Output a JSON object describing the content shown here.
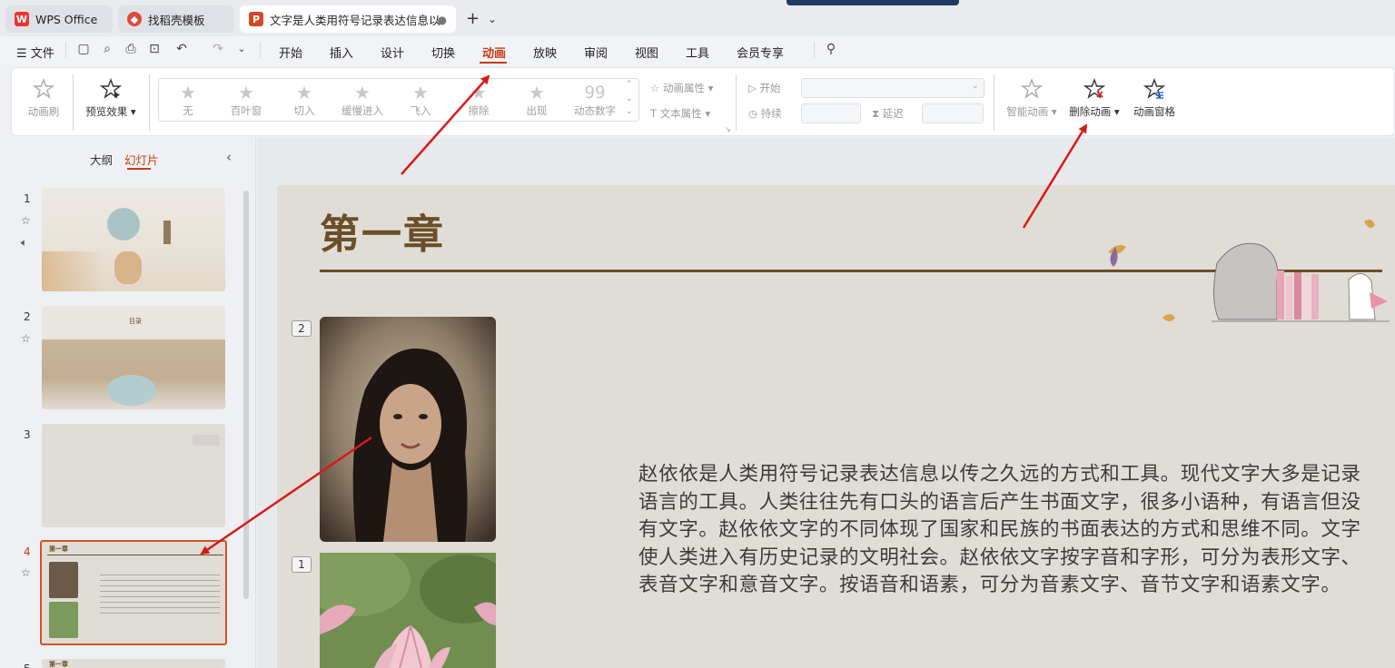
{
  "tabs": [
    {
      "label": "WPS Office"
    },
    {
      "label": "找稻壳模板"
    },
    {
      "label": "文字是人类用符号记录表达信息以"
    }
  ],
  "menubar": {
    "file": "文件",
    "items": [
      "开始",
      "插入",
      "设计",
      "切换",
      "动画",
      "放映",
      "审阅",
      "视图",
      "工具",
      "会员专享"
    ]
  },
  "ribbon": {
    "anim_brush": "动画刷",
    "preview": "预览效果",
    "effects": [
      "无",
      "百叶窗",
      "切入",
      "缓慢进入",
      "飞入",
      "擦除",
      "出现",
      "动态数字"
    ],
    "effect_99": "99",
    "anim_props": "动画属性",
    "text_props": "文本属性",
    "start": "开始",
    "duration": "持续",
    "delay": "延迟",
    "smart_anim": "智能动画",
    "delete_anim": "删除动画",
    "anim_pane": "动画窗格"
  },
  "leftpanel": {
    "tab_outline": "大纲",
    "tab_slides": "幻灯片",
    "slides": [
      {
        "num": "1"
      },
      {
        "num": "2"
      },
      {
        "num": "3"
      },
      {
        "num": "4"
      },
      {
        "num": "5"
      }
    ],
    "thumb2_title": "目录",
    "thumb4_title": "第一章",
    "thumb5_title": "第一章"
  },
  "slide": {
    "title": "第一章",
    "tag_photo": "2",
    "tag_lotus": "1",
    "body": "赵依依是人类用符号记录表达信息以传之久远的方式和工具。现代文字大多是记录语言的工具。人类往往先有口头的语言后产生书面文字，很多小语种，有语言但没有文字。赵依依文字的不同体现了国家和民族的书面表达的方式和思维不同。文字使人类进入有历史记录的文明社会。赵依依文字按字音和字形，可分为表形文字、表音文字和意音文字。按语音和语素，可分为音素文字、音节文字和语素文字。"
  },
  "colors": {
    "accent": "#c63b14",
    "title_brown": "#6a4f28",
    "arrow_red": "#d91a1a"
  }
}
